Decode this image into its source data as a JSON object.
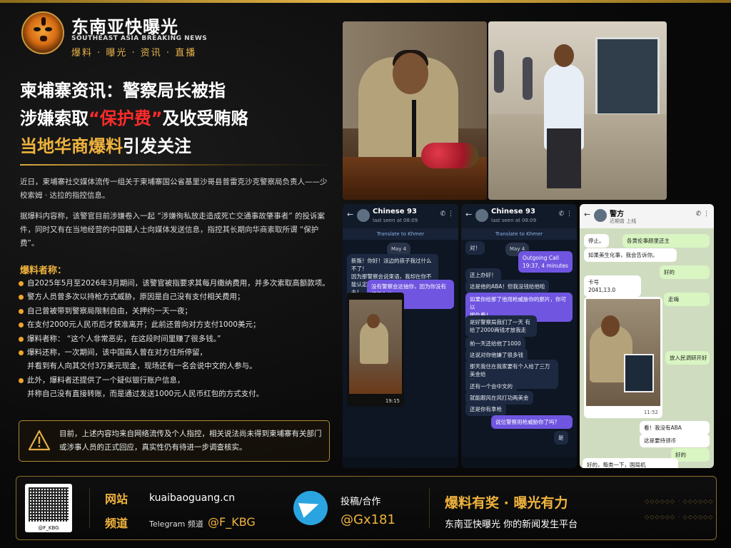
{
  "brand": {
    "name_cn": "东南亚快曝光",
    "name_en": "SOUTHEAST ASIA BREAKING NEWS",
    "sub": "爆料 · 曝光 · 资讯 · 直播"
  },
  "headline": {
    "line1": "柬埔寨资讯：警察局长被指",
    "line2_a": "涉嫌索取",
    "line2_quote": "“保护费”",
    "line2_b": "及收受贿赂",
    "line3_gold": "当地华商爆料",
    "line3_b": "引发关注"
  },
  "paragraphs": {
    "p1": "近日，柬埔寨社交媒体流传一组关于柬埔寨国公省基里沙哥县普雷克沙克警察局负责人——少校索姆 · 达拉的指控信息。",
    "p2": "据爆料内容称，该警官目前涉嫌卷入一起 “涉嫌徇私放走造成死亡交通事故肇事者” 的投诉案件，同时又有在当地经营的中国籍人士向媒体发送信息，指控其长期向华商索取所谓 “保护费”。"
  },
  "section_title": "爆料者称：",
  "bullets": [
    {
      "text": "自2025年5月至2026年3月期间，该警官被指要求其每月缴纳费用，并多次索取高额款项。",
      "dot": true
    },
    {
      "text": "警方人员曾多次以持枪方式威胁，原因是自己没有支付相关费用；",
      "dot": true
    },
    {
      "text": "自己曾被带到警察局限制自由，关押约一天一夜；",
      "dot": true
    },
    {
      "text": "在支付2000元人民币后才获准离开；此前还曾向对方支付1000美元；",
      "dot": true
    },
    {
      "text": "爆料者称：  “这个人非常恶劣，在这段时间里赚了很多钱。”",
      "dot": true
    },
    {
      "text": "爆料还称，一次期间，该中国商人曾在对方住所停留，",
      "dot": true
    },
    {
      "text": "并看到有人向其交付3万美元现金，现场还有一名会说中文的人参与。",
      "dot": false
    },
    {
      "text": "此外，爆料者还提供了一个疑似银行账户信息，",
      "dot": true
    },
    {
      "text": "并称自己没有直接转账，而是通过发送1000元人民币红包的方式支付。",
      "dot": false
    }
  ],
  "warning": "目前，上述内容均来自网络流传及个人指控，相关说法尚未得到柬埔寨有关部门或涉事人员的正式回应，真实性仍有待进一步调查核实。",
  "phones": {
    "chat1": {
      "name": "Chinese 93",
      "seen": "last seen at 08:09",
      "translate": "Translate to Khmer",
      "date": "May 4",
      "msgs": [
        "新叛！你好！派边的孩子我过什么不了！",
        "因为那警察会说柬语，我却在你不能认定。",
        "去！",
        "没有警察会这抽你，因为你没有按缴你的",
        "事！"
      ],
      "img_time": "19:15",
      "footer_time": "19:15"
    },
    "chat2": {
      "name": "Chinese 93",
      "seen": "last seen at 08:09",
      "translate": "Translate to Khmer",
      "date": "May 4",
      "msgs": [
        "对！",
        "Outgoing Call",
        "19:37, 4 minutes",
        "还上办好！",
        "这是他的ABA！但我没钱给他啦",
        "如果你给那了他用枪威胁你的那片，你可以",
        "报仇看！",
        "是好警察局我们了一天  有",
        "给了2000两钱才放我走",
        "前一天还给他了1000",
        "这说对你他嫌了很多钱",
        "那天我住在我家要有个人给了三万美金给",
        "他",
        "还有一个会中文的",
        "就能跟风在风打功两美金",
        "还是你有拿枪",
        "说位警察用枪威胁你了吗？",
        "是"
      ]
    },
    "chat3": {
      "name": "警方",
      "seen": "近期曾 上线",
      "msgs": [
        "停止。",
        "各黄伦事颜里还主",
        "如果美生化事，我会告诉你。",
        "好的",
        "卡号",
        "2041,13.0",
        "走嗨",
        "放入民调研开好",
        "看！我没有ABA",
        "这是要持领币",
        "好的",
        "好的，每类一下，国局机"
      ],
      "img_time": "11:52"
    }
  },
  "footer": {
    "site_label": "网站",
    "site": "kuaibaoguang.cn",
    "tg_label": "频道",
    "tg_small": "Telegram 频道",
    "tg_handle": "@F_KBG",
    "qr_label": "@F_KBG",
    "contact_label": "投稿/合作",
    "contact": "@Gx181",
    "slogan": "爆料有奖 · 曝光有力",
    "tagline": "东南亚快曝光    你的新闻发生平台",
    "dots": "◇◇◇◇◇◇ · ◇◇◇◇◇◇"
  }
}
